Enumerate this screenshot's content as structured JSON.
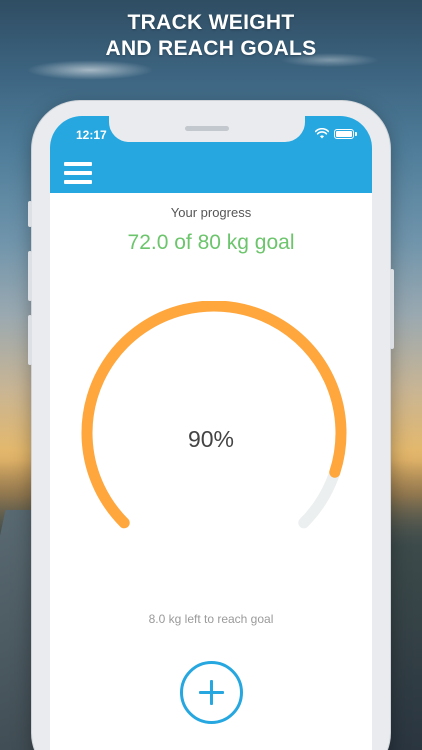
{
  "headline": {
    "line1": "TRACK WEIGHT",
    "line2": "AND REACH GOALS"
  },
  "status_bar": {
    "time": "12:17",
    "icons": [
      "wifi-icon",
      "battery-icon"
    ]
  },
  "header": {
    "menu_icon": "hamburger-menu-icon",
    "accent_color": "#26a7e0"
  },
  "progress": {
    "label": "Your progress",
    "value_text": "72.0 of 80 kg goal",
    "value_color": "#6cc56c",
    "percent_text": "90%",
    "fraction": 0.9,
    "arc_color": "#ffa73c",
    "track_color": "#ecefef",
    "left_text": "8.0 kg left to reach goal"
  },
  "actions": {
    "add_icon": "plus-icon"
  }
}
